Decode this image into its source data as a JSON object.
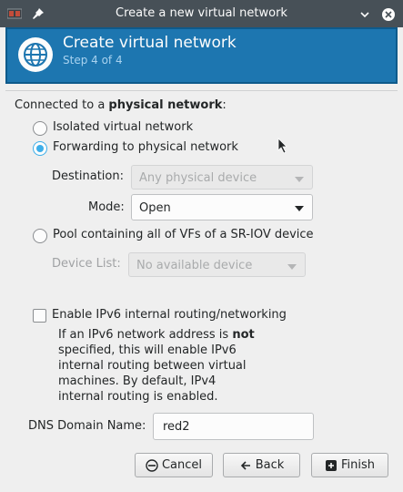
{
  "window": {
    "title": "Create a new virtual network"
  },
  "header": {
    "title": "Create virtual network",
    "step": "Step 4 of 4"
  },
  "connection": {
    "prefix": "Connected to a ",
    "emphasis": "physical network",
    "suffix": ":",
    "options": [
      {
        "label": "Isolated virtual network",
        "selected": false
      },
      {
        "label": "Forwarding to physical network",
        "selected": true
      },
      {
        "label": "Pool containing all of VFs of a SR-IOV device",
        "selected": false
      }
    ]
  },
  "forwarding": {
    "destination_label": "Destination:",
    "destination_value": "Any physical device",
    "mode_label": "Mode:",
    "mode_value": "Open"
  },
  "pool": {
    "device_list_label": "Device List:",
    "device_list_value": "No available device"
  },
  "ipv6": {
    "label": "Enable IPv6 internal routing/networking",
    "checked": false,
    "help_l1_pre": "If an IPv6 network address is ",
    "help_l1_bold": "not",
    "help_l2": "specified, this will enable IPv6",
    "help_l3": "internal routing between virtual",
    "help_l4": "machines.  By default, IPv4",
    "help_l5": "internal routing is enabled."
  },
  "dns": {
    "label": "DNS Domain Name:",
    "value": "red2"
  },
  "buttons": {
    "cancel": "Cancel",
    "back": "Back",
    "finish": "Finish"
  },
  "colors": {
    "accent": "#3daee9",
    "header_bg": "#1d76b0",
    "titlebar_bg": "#475057"
  }
}
